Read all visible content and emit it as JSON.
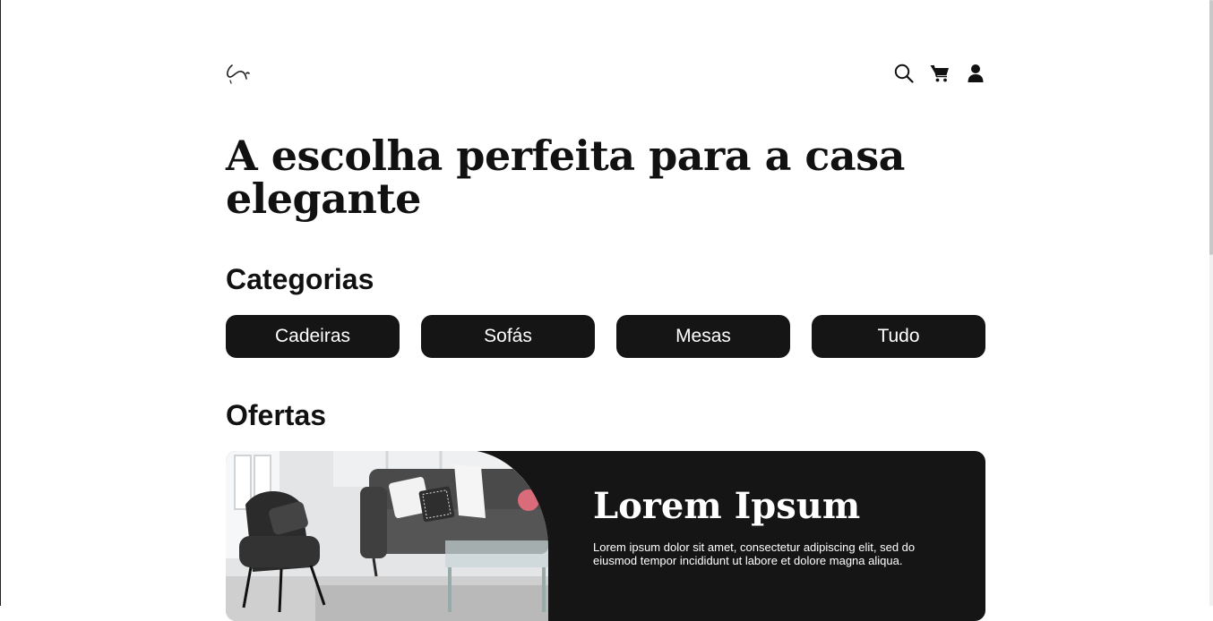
{
  "header": {
    "logo_icon": "swirl-logo-icon",
    "icons": [
      "search-icon",
      "cart-icon",
      "user-icon"
    ]
  },
  "hero": {
    "title": "A escolha perfeita para a casa elegante"
  },
  "categories": {
    "heading": "Categorias",
    "items": [
      {
        "label": "Cadeiras"
      },
      {
        "label": "Sofás"
      },
      {
        "label": "Mesas"
      },
      {
        "label": "Tudo"
      }
    ]
  },
  "offers": {
    "heading": "Ofertas",
    "card": {
      "title": "Lorem Ipsum",
      "description": "Lorem ipsum dolor sit amet, consectetur adipiscing elit, sed do eiusmod tempor incididunt ut labore et dolore magna aliqua."
    }
  },
  "colors": {
    "background": "#ffffff",
    "dark": "#151515",
    "text_light": "#ffffff"
  }
}
